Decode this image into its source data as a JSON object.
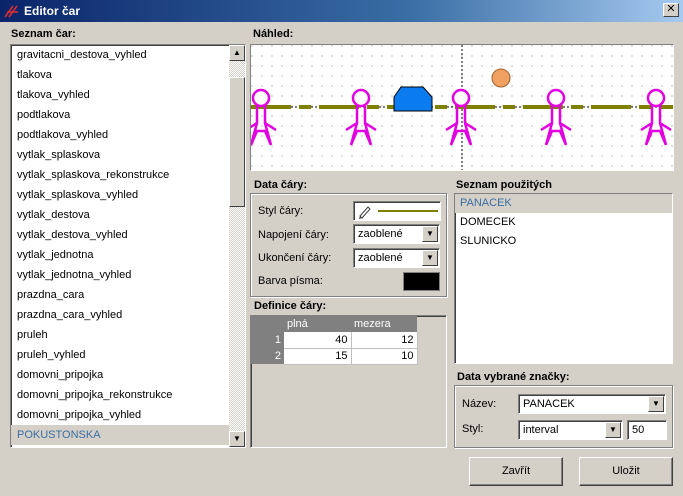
{
  "window": {
    "title": "Editor čar",
    "close_glyph": "✕"
  },
  "lines_list": {
    "label": "Seznam čar:",
    "items": [
      "gravitacni_destova_vyhled",
      "tlakova",
      "tlakova_vyhled",
      "podtlakova",
      "podtlakova_vyhled",
      "vytlak_splaskova",
      "vytlak_splaskova_rekonstrukce",
      "vytlak_splaskova_vyhled",
      "vytlak_destova",
      "vytlak_destova_vyhled",
      "vytlak_jednotna",
      "vytlak_jednotna_vyhled",
      "prazdna_cara",
      "prazdna_cara_vyhled",
      "pruleh",
      "pruleh_vyhled",
      "domovni_pripojka",
      "domovni_pripojka_rekonstrukce",
      "domovni_pripojka_vyhled",
      "POKUSTONSKA"
    ],
    "selected": "POKUSTONSKA"
  },
  "preview": {
    "label": "Náhled:",
    "line_color": "#808000",
    "figure_color": "#e000e0",
    "house_color": "#0a7cf0",
    "sun_color": "#f0a060"
  },
  "line_data": {
    "label": "Data čáry:",
    "style_label": "Styl čáry:",
    "join_label": "Napojení čáry:",
    "join_value": "zaoblené",
    "end_label": "Ukončení čáry:",
    "end_value": "zaoblené",
    "font_color_label": "Barva písma:",
    "font_color": "#000000"
  },
  "definition": {
    "label": "Definice čáry:",
    "columns": [
      "plná",
      "mezera"
    ],
    "rows": [
      {
        "n": "1",
        "plna": "40",
        "mezera": "12"
      },
      {
        "n": "2",
        "plna": "15",
        "mezera": "10"
      }
    ]
  },
  "used_list": {
    "label": "Seznam použitých",
    "items": [
      "PANACEK",
      "DOMECEK",
      "SLUNICKO"
    ],
    "selected": "PANACEK"
  },
  "selected_mark": {
    "label": "Data vybrané značky:",
    "name_label": "Název:",
    "name_value": "PANACEK",
    "style_label": "Styl:",
    "style_value": "interval",
    "interval_value": "50"
  },
  "buttons": {
    "close": "Zavřít",
    "save": "Uložit"
  }
}
